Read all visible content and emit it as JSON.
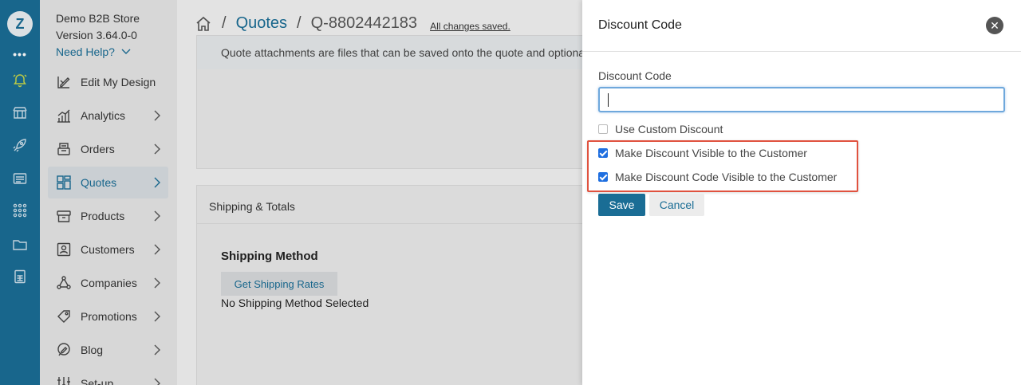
{
  "rail": {
    "logo_glyph": "Z",
    "more_glyph": "•••",
    "icons": [
      "bell-icon",
      "store-icon",
      "rocket-icon",
      "media-icon",
      "apps-grid-icon",
      "folder-icon",
      "spreadsheet-icon"
    ],
    "accent_color": "#c7d64a"
  },
  "nav": {
    "store_name": "Demo B2B Store",
    "version": "Version 3.64.0-0",
    "need_help": "Need Help?",
    "items": [
      {
        "label": "Edit My Design",
        "icon": "edit-design-icon",
        "has_chevron": false,
        "active": false
      },
      {
        "label": "Analytics",
        "icon": "analytics-icon",
        "has_chevron": true,
        "active": false
      },
      {
        "label": "Orders",
        "icon": "orders-icon",
        "has_chevron": true,
        "active": false
      },
      {
        "label": "Quotes",
        "icon": "quotes-icon",
        "has_chevron": true,
        "active": true
      },
      {
        "label": "Products",
        "icon": "products-icon",
        "has_chevron": true,
        "active": false
      },
      {
        "label": "Customers",
        "icon": "customers-icon",
        "has_chevron": true,
        "active": false
      },
      {
        "label": "Companies",
        "icon": "companies-icon",
        "has_chevron": true,
        "active": false
      },
      {
        "label": "Promotions",
        "icon": "promotions-icon",
        "has_chevron": true,
        "active": false
      },
      {
        "label": "Blog",
        "icon": "blog-icon",
        "has_chevron": true,
        "active": false
      },
      {
        "label": "Set-up",
        "icon": "setup-icon",
        "has_chevron": true,
        "active": false
      }
    ]
  },
  "main": {
    "breadcrumb": {
      "sep": "/",
      "quotes": "Quotes",
      "current": "Q-8802442183",
      "saved": "All changes saved."
    },
    "attachments_hint": "Quote attachments are files that can be saved onto the quote and optionally",
    "shipping": {
      "header": "Shipping & Totals",
      "method_title": "Shipping Method",
      "get_rates": "Get Shipping Rates",
      "no_method": "No Shipping Method Selected"
    }
  },
  "drawer": {
    "title": "Discount Code",
    "close_glyph": "✕",
    "field_label": "Discount Code",
    "field_value": "",
    "options": [
      {
        "label": "Use Custom Discount",
        "checked": false
      },
      {
        "label": "Make Discount Visible to the Customer",
        "checked": true
      },
      {
        "label": "Make Discount Code Visible to the Customer",
        "checked": true
      }
    ],
    "save": "Save",
    "cancel": "Cancel"
  },
  "colors": {
    "brand": "#1a6d95",
    "highlight": "#e0523f",
    "checkbox": "#1f6fe0"
  }
}
